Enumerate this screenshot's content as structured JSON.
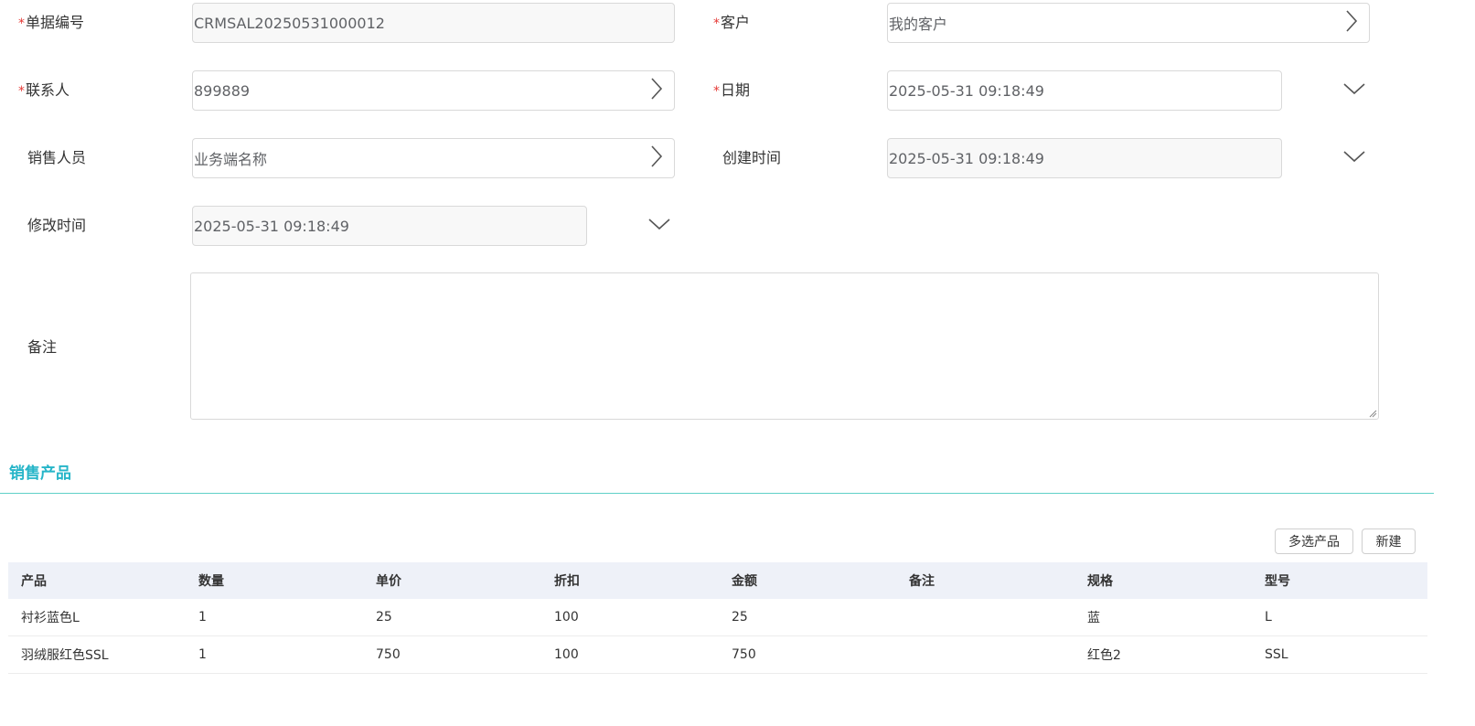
{
  "form": {
    "order_no": {
      "label": "单据编号",
      "required": true,
      "value": "CRMSAL20250531000012"
    },
    "customer": {
      "label": "客户",
      "required": true,
      "value": "我的客户"
    },
    "contact": {
      "label": "联系人",
      "required": true,
      "value": "899889"
    },
    "date": {
      "label": "日期",
      "required": true,
      "value": "2025-05-31 09:18:49"
    },
    "salesperson": {
      "label": "销售人员",
      "required": false,
      "value": "业务端名称"
    },
    "created_time": {
      "label": "创建时间",
      "required": false,
      "value": "2025-05-31 09:18:49"
    },
    "modified_time": {
      "label": "修改时间",
      "required": false,
      "value": "2025-05-31 09:18:49"
    },
    "remark": {
      "label": "备注",
      "required": false,
      "value": ""
    },
    "required_mark": "*"
  },
  "products": {
    "section_title": "销售产品",
    "buttons": {
      "multi_select": "多选产品",
      "new": "新建"
    },
    "columns": [
      "产品",
      "数量",
      "单价",
      "折扣",
      "金额",
      "备注",
      "规格",
      "型号"
    ],
    "rows": [
      [
        "衬衫蓝色L",
        "1",
        "25",
        "100",
        "25",
        "",
        "蓝",
        "L"
      ],
      [
        "羽绒服红色SSL",
        "1",
        "750",
        "100",
        "750",
        "",
        "红色2",
        "SSL"
      ]
    ]
  },
  "colors": {
    "accent": "#26b5c8",
    "divider": "#5fd0c8",
    "required": "#e53935",
    "table_header_bg": "#eef1f8"
  },
  "icons": {
    "picker": "chevron-right-icon",
    "dropdown": "chevron-down-icon"
  }
}
